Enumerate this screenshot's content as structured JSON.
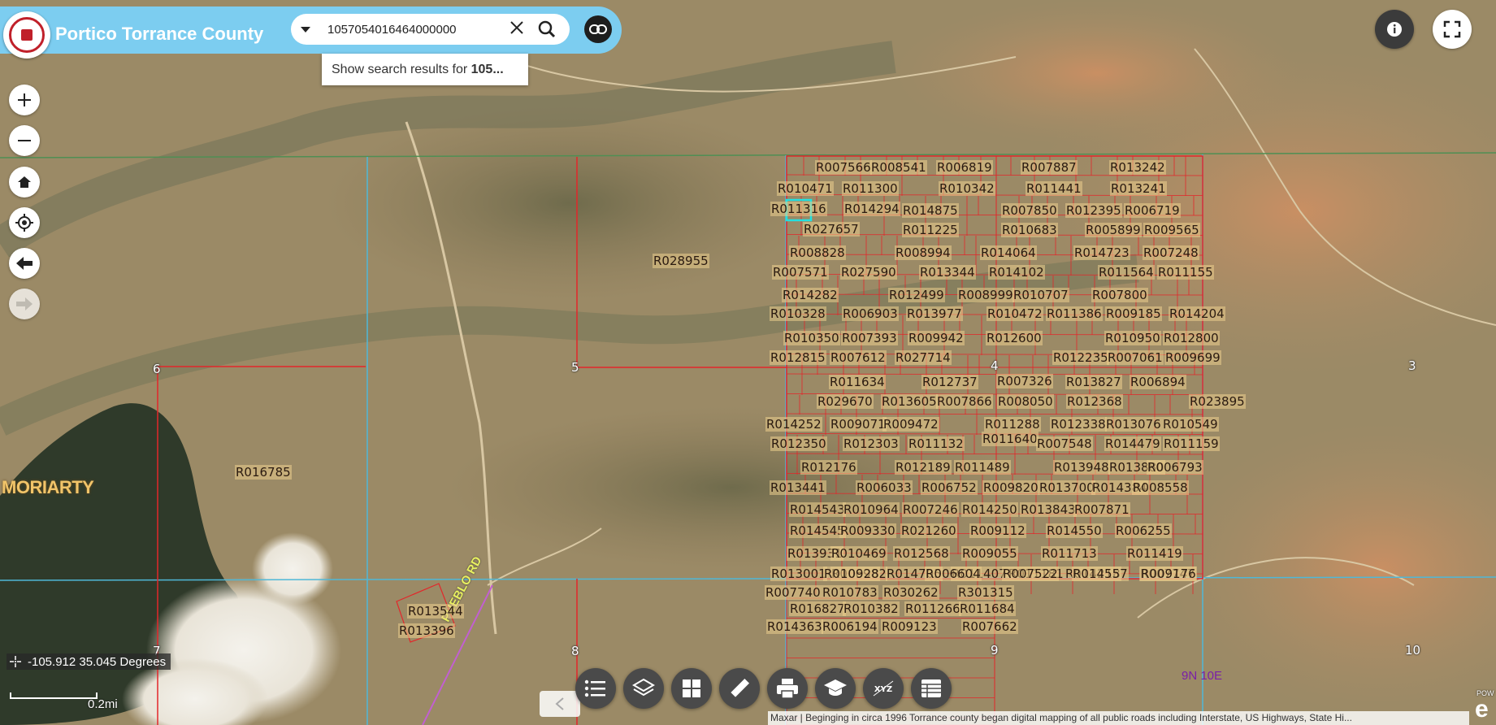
{
  "header": {
    "title": "Portico Torrance County",
    "search_value": "1057054016464000000",
    "suggestion_prefix": "Show search results for ",
    "suggestion_term": "105..."
  },
  "map": {
    "town": "MORIARTY",
    "coordinates": "-105.912 35.045 Degrees",
    "scale": "0.2mi",
    "grid_ref": "9N 10E",
    "road": "PUEBLO RD",
    "attribution": "Maxar | Beginging in circa 1996 Torrance county began digital mapping of all public roads including Interstate, US Highways, State Hi...",
    "powered": "POW",
    "esri": "e",
    "sections": [
      "6",
      "5",
      "4",
      "3",
      "7",
      "8",
      "9",
      "10"
    ],
    "parcels": [
      "R007566",
      "R008541",
      "R006819",
      "R007887",
      "R013242",
      "R010471",
      "R011300",
      "R010342",
      "R011441",
      "R013241",
      "R011316",
      "R014294",
      "R014875",
      "R007850",
      "R012395",
      "R006719",
      "R027657",
      "R011225",
      "R010683",
      "R005899",
      "R009565",
      "R028955",
      "R008828",
      "R008994",
      "R014064",
      "R014723",
      "R007248",
      "R007571",
      "R027590",
      "R013344",
      "R014102",
      "R011564",
      "R011155",
      "R014282",
      "R012499",
      "R008999",
      "R010707",
      "R007800",
      "R010328",
      "R006903",
      "R013977",
      "R010472",
      "R011386",
      "R009185",
      "R014204",
      "R010350",
      "R007393",
      "R009942",
      "R012600",
      "R010950",
      "R012800",
      "R012815",
      "R007612",
      "R027714",
      "R012235",
      "R007061",
      "R009699",
      "R011634",
      "R012737",
      "R007326",
      "R013827",
      "R006894",
      "R029670",
      "R013605",
      "R007866",
      "R008050",
      "R012368",
      "R023895",
      "R014252",
      "R009071",
      "R009472",
      "R011288",
      "R012338",
      "R013076",
      "R010549",
      "R012350",
      "R012303",
      "R011132",
      "R011640",
      "R007548",
      "R014479",
      "R011159",
      "R016785",
      "R012176",
      "R012189",
      "R011489",
      "R013948",
      "R013880",
      "R006793",
      "R013441",
      "R006033",
      "R006752",
      "R009820",
      "R013700",
      "R014384",
      "R008558",
      "R014543",
      "R010964",
      "R007246",
      "R014250",
      "R013843",
      "R007871",
      "R014545",
      "R009330",
      "R021260",
      "R009112",
      "R014550",
      "R006255",
      "R013931",
      "R010469",
      "R012568",
      "R009055",
      "R011713",
      "R011419",
      "R013001",
      "R006982",
      "R014705",
      "R011407",
      "R011181",
      "R014218",
      "R007747",
      "R010928",
      "R006604",
      "R007522",
      "R014557",
      "R009176",
      "R007740",
      "R010783",
      "R030262",
      "R301315",
      "R016827",
      "R010382",
      "R011266",
      "R011684",
      "R014363",
      "R006194",
      "R009123",
      "R007662",
      "R013544",
      "R013396"
    ]
  },
  "controls": [
    "zoom-in",
    "zoom-out",
    "home",
    "my-location",
    "back",
    "forward"
  ],
  "toolbar": [
    "list",
    "layers",
    "basemap",
    "measure",
    "print",
    "education",
    "xyz",
    "table"
  ],
  "colors": {
    "header": "#7ccdf0",
    "parcel_line": "#e3262a",
    "section_line": "#4fb8d8",
    "road": "#d8c7a3"
  }
}
